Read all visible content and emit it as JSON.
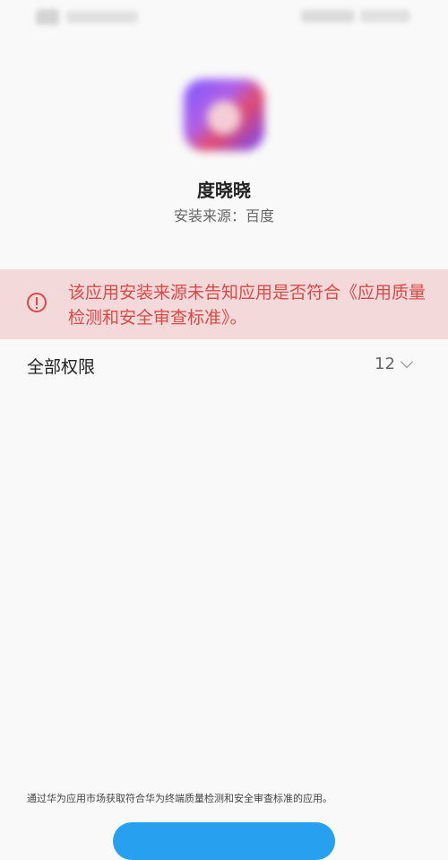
{
  "app": {
    "name": "度晓晓",
    "source": "安装来源：百度"
  },
  "warning": {
    "text": "该应用安装来源未告知应用是否符合《应用质量检测和安全审查标准》。"
  },
  "permissions": {
    "title": "全部权限",
    "count": "12"
  },
  "footer": {
    "note": "通过华为应用市场获取符合华为终端质量检测和安全审查标准的应用。"
  },
  "colors": {
    "warning_bg": "#f4d9da",
    "warning_text": "#d94a47",
    "button": "#27a0f0"
  }
}
